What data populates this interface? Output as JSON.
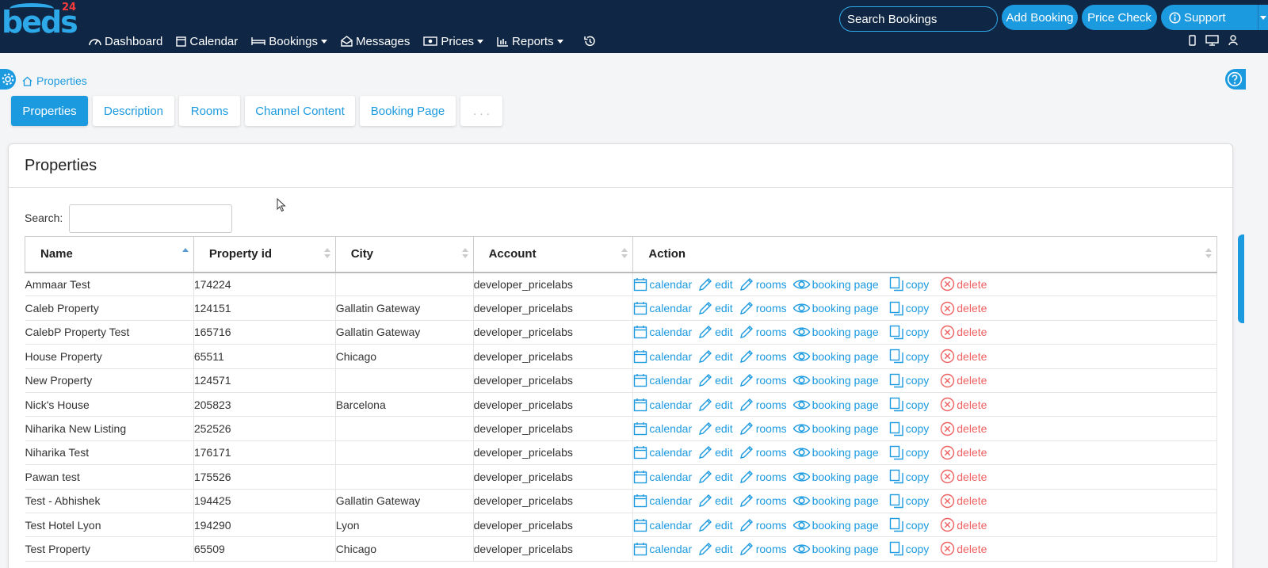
{
  "header": {
    "logo_text": "beds",
    "logo_sup": "24",
    "search_placeholder": "Search Bookings",
    "add_booking": "Add Booking",
    "price_check": "Price Check",
    "support": "Support"
  },
  "nav": {
    "dashboard": "Dashboard",
    "calendar": "Calendar",
    "bookings": "Bookings",
    "messages": "Messages",
    "prices": "Prices",
    "reports": "Reports"
  },
  "breadcrumb": "Properties",
  "tabs": [
    "Properties",
    "Description",
    "Rooms",
    "Channel Content",
    "Booking Page",
    ". . ."
  ],
  "panel": {
    "title": "Properties",
    "search_label": "Search:",
    "search_value": ""
  },
  "table": {
    "headers": [
      "Name",
      "Property id",
      "City",
      "Account",
      "Action"
    ],
    "actions": {
      "calendar": "calendar",
      "edit": "edit",
      "rooms": "rooms",
      "booking_page": "booking page",
      "copy": "copy",
      "delete": "delete"
    },
    "rows": [
      {
        "name": "Ammaar Test",
        "id": "174224",
        "city": "",
        "account": "developer_pricelabs"
      },
      {
        "name": "Caleb Property",
        "id": "124151",
        "city": "Gallatin Gateway",
        "account": "developer_pricelabs"
      },
      {
        "name": "CalebP Property Test",
        "id": "165716",
        "city": "Gallatin Gateway",
        "account": "developer_pricelabs"
      },
      {
        "name": "House Property",
        "id": "65511",
        "city": "Chicago",
        "account": "developer_pricelabs"
      },
      {
        "name": "New Property",
        "id": "124571",
        "city": "",
        "account": "developer_pricelabs"
      },
      {
        "name": "Nick's House",
        "id": "205823",
        "city": "Barcelona",
        "account": "developer_pricelabs"
      },
      {
        "name": "Niharika New Listing",
        "id": "252526",
        "city": "",
        "account": "developer_pricelabs"
      },
      {
        "name": "Niharika Test",
        "id": "176171",
        "city": "",
        "account": "developer_pricelabs"
      },
      {
        "name": "Pawan test",
        "id": "175526",
        "city": "",
        "account": "developer_pricelabs"
      },
      {
        "name": "Test - Abhishek",
        "id": "194425",
        "city": "Gallatin Gateway",
        "account": "developer_pricelabs"
      },
      {
        "name": "Test Hotel Lyon",
        "id": "194290",
        "city": "Lyon",
        "account": "developer_pricelabs"
      },
      {
        "name": "Test Property",
        "id": "65509",
        "city": "Chicago",
        "account": "developer_pricelabs"
      }
    ]
  },
  "colors": {
    "topbar": "#0f2745",
    "accent": "#1c9ae0",
    "delete": "#f06060"
  }
}
